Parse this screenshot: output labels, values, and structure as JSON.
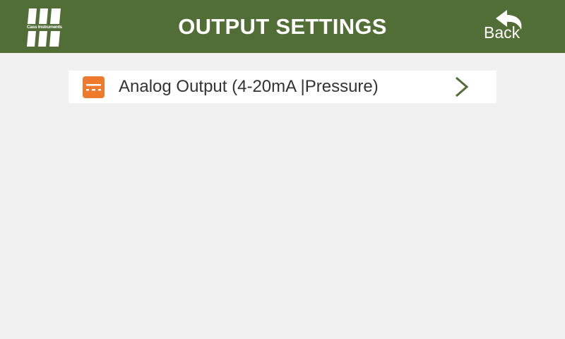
{
  "header": {
    "title": "OUTPUT SETTINGS",
    "logo_text": "Cass Instruments",
    "back_label": "Back",
    "background_color": "#526e37",
    "text_color": "#ffffff"
  },
  "menu": {
    "items": [
      {
        "label": "Analog Output (4-20mA |Pressure)",
        "icon": "output-card-icon",
        "icon_color": "#ef7a2d",
        "chevron": "chevron-right-icon",
        "chevron_color": "#526e37"
      }
    ]
  },
  "page": {
    "background_color": "#f0f0f0"
  }
}
